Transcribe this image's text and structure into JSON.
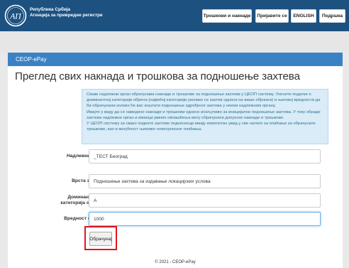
{
  "header": {
    "brand_line1": "Република Србија",
    "brand_line2": "Агенција за привредне регистре",
    "nav": [
      {
        "label": "Трошкови и накнаде"
      },
      {
        "label": "Пријавите се"
      },
      {
        "label": "ENGLISH"
      },
      {
        "label": "Подршка"
      }
    ]
  },
  "panel": {
    "title": "CEOP-ePay",
    "heading": "Преглед свих накнада и трошкова за подношење захтева"
  },
  "info": {
    "p1": "Сваки надлежни орган обрачунава накнаде и трошкове за подношење захтева у ЦЕОП систему. Унесите податке о доминантној категорији објекта (највећој категорији уколико се захтев односи на више објеката) и његовој вредности да би обрачунали колико ће вас коштати подношење одређеног захтева у неком надлежном органу.",
    "p2": "Имајте у виду да се наведене накнаде и трошкови односе искључиво за иницијално подношење захтева. У току обраде захтева надлежни орган и имаоци јавних овлашћења могу обрачунати допунске накнаде и трошкове.",
    "p3": "У ЦЕОП систему за свако поднете захтеве подносиоци имају комплетан увид у све налоге за плаћање за обрачунате трошкове, као и могућност њиховог електронског плаћања."
  },
  "form": {
    "authority_label": "Надлежни орган",
    "authority_value": "_ТЕСТ Београд",
    "request_type_label": "Врста захтева",
    "request_type_value": "Подношење захтева за издавање локацијских услова",
    "category_label_1": "Доминантна",
    "category_label_2": "категорија објекта",
    "category_value": "А",
    "object_value_label": "Вредност објекта",
    "object_value": "1000",
    "calculate_label": "Обрачунај"
  },
  "footer": {
    "text": "© 2021 - CEOP-ePay"
  },
  "colors": {
    "header_bg": "#1c5180",
    "panel_head": "#3b82c4",
    "info_bg": "#d9ecf7",
    "highlight_border": "#e0161b"
  }
}
